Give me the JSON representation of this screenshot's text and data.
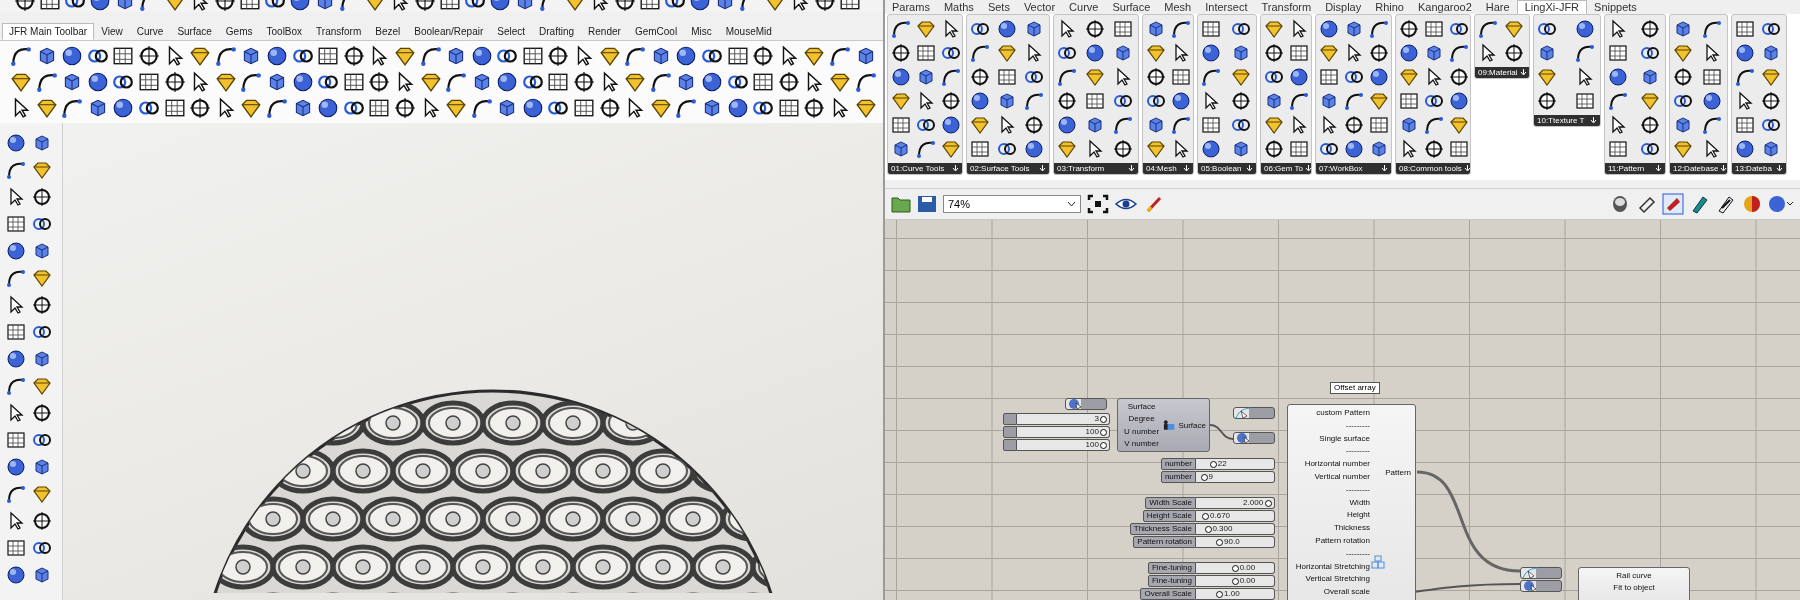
{
  "rhino": {
    "tabs": [
      {
        "label": "JFR Main Toolbar",
        "selected": true
      },
      {
        "label": "View",
        "selected": false
      },
      {
        "label": "Curve",
        "selected": false
      },
      {
        "label": "Surface",
        "selected": false
      },
      {
        "label": "Gems",
        "selected": false
      },
      {
        "label": "ToolBox",
        "selected": false
      },
      {
        "label": "Transform",
        "selected": false
      },
      {
        "label": "Bezel",
        "selected": false
      },
      {
        "label": "Boolean/Repair",
        "selected": false
      },
      {
        "label": "Select",
        "selected": false
      },
      {
        "label": "Drafting",
        "selected": false
      },
      {
        "label": "Render",
        "selected": false
      },
      {
        "label": "GemCool",
        "selected": false
      },
      {
        "label": "Misc",
        "selected": false
      },
      {
        "label": "MouseMid",
        "selected": false
      }
    ]
  },
  "grasshopper": {
    "tabs": [
      {
        "label": "Params",
        "selected": false
      },
      {
        "label": "Maths",
        "selected": false
      },
      {
        "label": "Sets",
        "selected": false
      },
      {
        "label": "Vector",
        "selected": false
      },
      {
        "label": "Curve",
        "selected": false
      },
      {
        "label": "Surface",
        "selected": false
      },
      {
        "label": "Mesh",
        "selected": false
      },
      {
        "label": "Intersect",
        "selected": false
      },
      {
        "label": "Transform",
        "selected": false
      },
      {
        "label": "Display",
        "selected": false
      },
      {
        "label": "Rhino",
        "selected": false
      },
      {
        "label": "Kangaroo2",
        "selected": false
      },
      {
        "label": "Hare",
        "selected": false
      },
      {
        "label": "LingXi-JFR",
        "selected": true
      },
      {
        "label": "Snippets",
        "selected": false
      }
    ],
    "panels": [
      {
        "label": "01:Curve Tools"
      },
      {
        "label": "02:Surface Tools"
      },
      {
        "label": "03:Transform"
      },
      {
        "label": "04:Mesh"
      },
      {
        "label": "05:Boolean"
      },
      {
        "label": "06:Gem To"
      },
      {
        "label": "07:WorkBox"
      },
      {
        "label": "08:Common tools"
      },
      {
        "label": "09:Material"
      },
      {
        "label": "10:Ttexture T"
      },
      {
        "label": "11:Pattern"
      },
      {
        "label": "12:Datebase"
      },
      {
        "label": "13:Dateba"
      }
    ],
    "zoom": "74%",
    "canvas": {
      "surface_component": {
        "inputs": [
          "Surface",
          "Degree",
          "U number",
          "V number"
        ],
        "output": "Surface"
      },
      "plain_sliders": [
        {
          "value": "3",
          "level": 0.93
        },
        {
          "value": "100",
          "level": 0.93
        },
        {
          "value": "100",
          "level": 0.93
        }
      ],
      "tooltip": "Offset array",
      "main_component": {
        "inputs": [
          "custom Pattern",
          "---------",
          "Single surface",
          "---------",
          "Horizontal number",
          "Vertical number",
          "---------",
          "Width",
          "Height",
          "Thickness",
          "Pattern rotation",
          "---------",
          "Horizontal Stretching",
          "Vertical Stretching",
          "Overall scale"
        ],
        "output": "Pattern"
      },
      "sliders": [
        {
          "label": "number",
          "value": "22",
          "level": 0.22
        },
        {
          "label": "number",
          "value": "9",
          "level": 0.1
        },
        {
          "label": "Width Scale",
          "value": "2.000",
          "level": 0.92
        },
        {
          "label": "Height Scale",
          "value": "0.670",
          "level": 0.12
        },
        {
          "label": "Thickness Scale",
          "value": "0.300",
          "level": 0.15
        },
        {
          "label": "Pattern rotation",
          "value": "90.0",
          "level": 0.3
        },
        {
          "label": "Fine-tuning",
          "value": "0.00",
          "level": 0.5
        },
        {
          "label": "Fine-tuning",
          "value": "0.00",
          "level": 0.5
        },
        {
          "label": "Overall Scale",
          "value": "1.00",
          "level": 0.3
        }
      ],
      "rail_component": {
        "inputs": [
          "Rail curve",
          "Fit to object"
        ]
      }
    }
  }
}
